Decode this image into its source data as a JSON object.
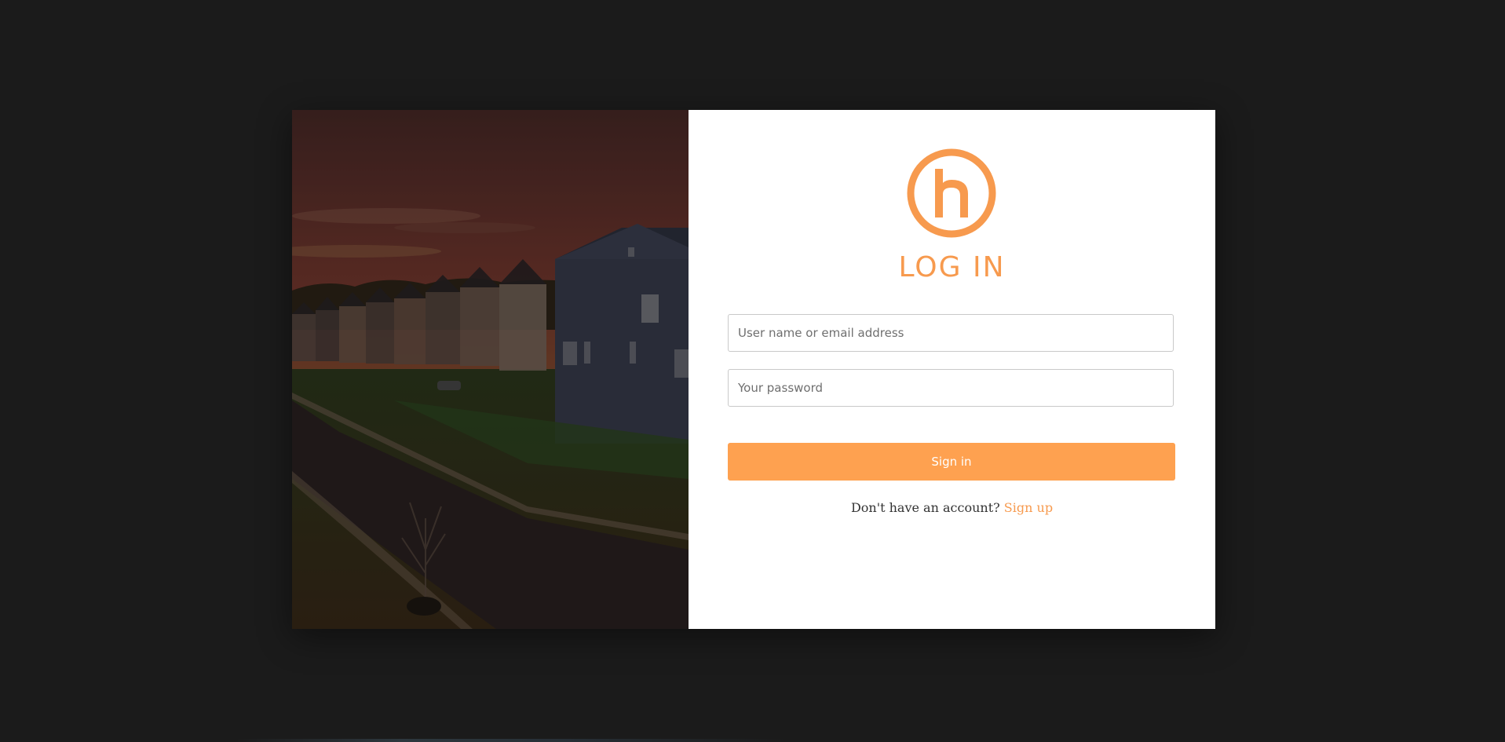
{
  "login": {
    "title": "LOG IN",
    "username_placeholder": "User name or email address",
    "password_placeholder": "Your password",
    "signin_label": "Sign in",
    "signup_prompt": "Don't have an account?",
    "signup_link": "Sign up"
  },
  "hero_image": {
    "subject": "suburban-houses-street-at-sunset"
  },
  "logo": {
    "icon": "house-h-logo-icon"
  },
  "colors": {
    "accent": "#f79a4e",
    "button": "#fea150",
    "backdrop": "#1b1b1b",
    "panel": "#ffffff"
  }
}
